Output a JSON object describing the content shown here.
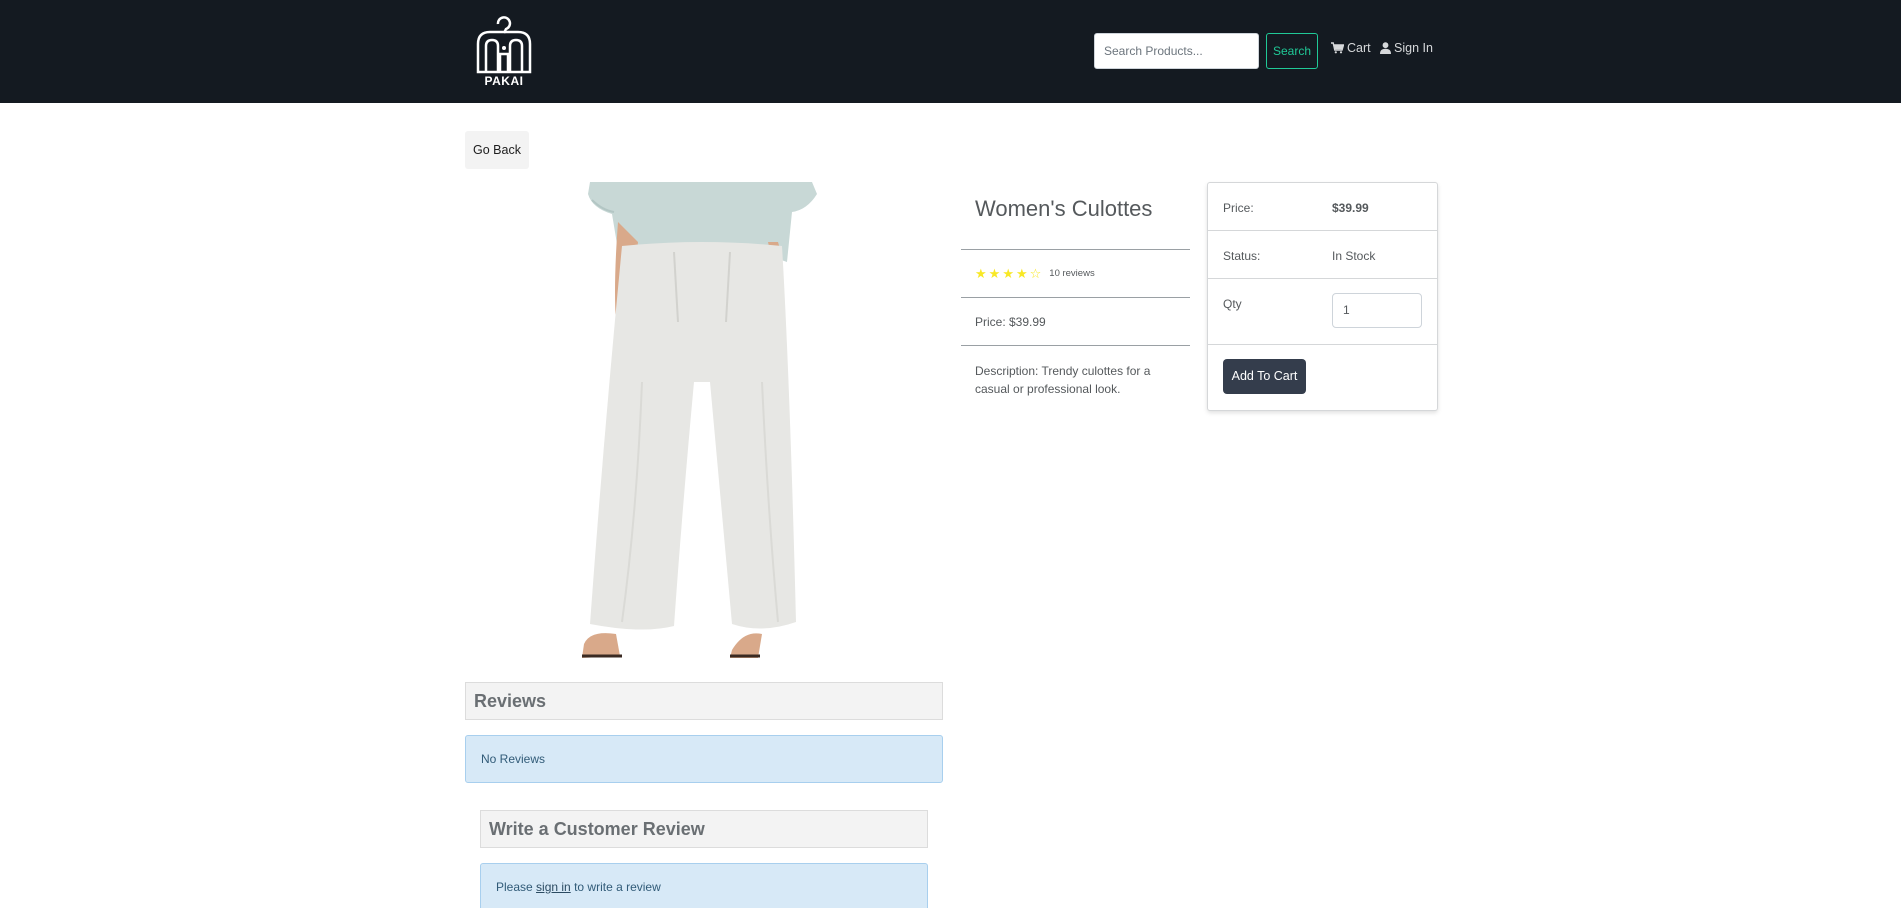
{
  "header": {
    "logo_text": "PAKAI",
    "search": {
      "placeholder": "Search Products..."
    },
    "search_button": "Search",
    "cart_label": "Cart",
    "signin_label": "Sign In"
  },
  "nav": {
    "go_back": "Go Back"
  },
  "product": {
    "name": "Women's Culottes",
    "rating": 4,
    "rating_max": 5,
    "reviews_text": "10 reviews",
    "price_line": "Price: $39.99",
    "description": "Description: Trendy culottes for a casual or professional look."
  },
  "cart_card": {
    "price_label": "Price:",
    "price_value": "$39.99",
    "status_label": "Status:",
    "status_value": "In Stock",
    "qty_label": "Qty",
    "qty_value": "1",
    "add_button": "Add To Cart"
  },
  "reviews": {
    "heading": "Reviews",
    "empty_message": "No Reviews",
    "write_heading": "Write a Customer Review",
    "signin_prefix": "Please",
    "signin_link": "sign in",
    "signin_suffix": "to write a review"
  },
  "colors": {
    "navbar": "#141a21",
    "accent": "#20c997",
    "star": "#f8e825",
    "button_dark": "#343d4c",
    "alert_bg": "#d7e9f7"
  }
}
